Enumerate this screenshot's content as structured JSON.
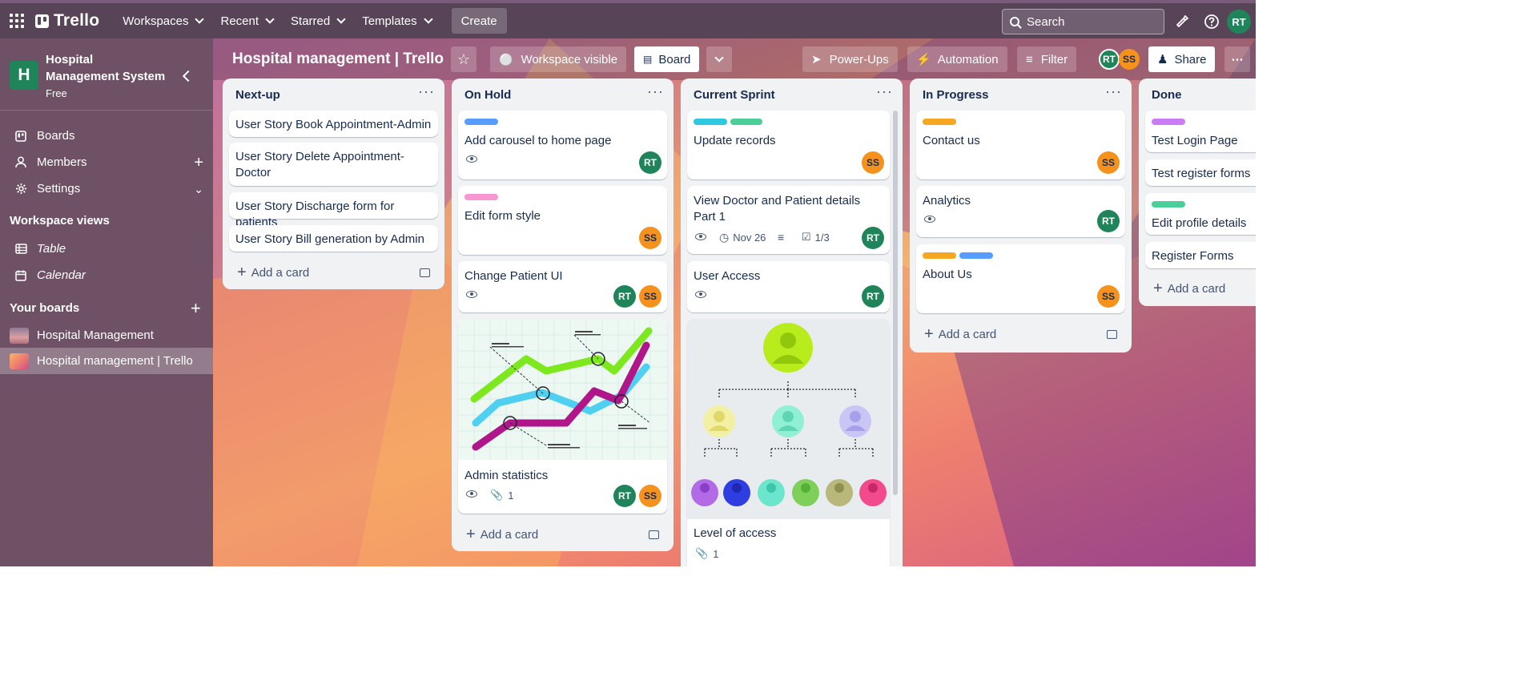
{
  "topbar": {
    "logo": "Trello",
    "nav": [
      "Workspaces",
      "Recent",
      "Starred",
      "Templates"
    ],
    "create": "Create",
    "search_placeholder": "Search",
    "user_initials": "RT"
  },
  "sidebar": {
    "workspace_name": "Hospital Management System",
    "workspace_initial": "H",
    "plan": "Free",
    "items": [
      {
        "label": "Boards",
        "icon": "board-icon"
      },
      {
        "label": "Members",
        "icon": "person-icon"
      },
      {
        "label": "Settings",
        "icon": "gear-icon"
      }
    ],
    "views_heading": "Workspace views",
    "views": [
      {
        "label": "Table",
        "icon": "table-icon"
      },
      {
        "label": "Calendar",
        "icon": "calendar-icon"
      }
    ],
    "boards_heading": "Your boards",
    "boards": [
      "Hospital Management",
      "Hospital management | Trello"
    ]
  },
  "board": {
    "title": "Hospital management | Trello",
    "visibility": "Workspace visible",
    "view": "Board",
    "powerups": "Power-Ups",
    "automation": "Automation",
    "filter": "Filter",
    "share": "Share",
    "members": [
      "RT",
      "SS"
    ]
  },
  "lists": [
    {
      "name": "Next-up",
      "cards": [
        {
          "title": "User Story Book Appointment-Admin"
        },
        {
          "title": "User Story Delete Appointment-Doctor"
        },
        {
          "title": "User Story Discharge form for patients"
        },
        {
          "title": "User Story Bill generation by Admin"
        }
      ],
      "add_card": "Add a card"
    },
    {
      "name": "On Hold",
      "cards": [
        {
          "title": "Add carousel to home page",
          "labels": [
            "#579dff"
          ],
          "members": [
            "RT"
          ]
        },
        {
          "title": "Edit form style",
          "labels": [
            "#f797d2"
          ],
          "members": [
            "SS"
          ]
        },
        {
          "title": "Change Patient UI",
          "members": [
            "RT",
            "SS"
          ]
        },
        {
          "title": "Admin statistics",
          "attachments": "1",
          "members": [
            "RT",
            "SS"
          ]
        }
      ],
      "add_card": "Add a card"
    },
    {
      "name": "Current Sprint",
      "cards": [
        {
          "title": "Update records",
          "labels": [
            "#2ec9e0",
            "#4bce97"
          ],
          "members": [
            "SS"
          ]
        },
        {
          "title": "View Doctor and Patient details Part 1",
          "due": "Nov 26",
          "checklist": "1/3",
          "members": [
            "RT"
          ]
        },
        {
          "title": "User Access",
          "members": [
            "RT"
          ]
        },
        {
          "title": "Level of access",
          "attachments": "1"
        }
      ]
    },
    {
      "name": "In Progress",
      "cards": [
        {
          "title": "Contact us",
          "labels": [
            "#f5a623"
          ],
          "members": [
            "SS"
          ]
        },
        {
          "title": "Analytics",
          "members": [
            "RT"
          ]
        },
        {
          "title": "About Us",
          "labels": [
            "#f5a623",
            "#579dff"
          ],
          "members": [
            "SS"
          ]
        }
      ],
      "add_card": "Add a card"
    },
    {
      "name": "Done",
      "cards": [
        {
          "title": "Test Login Page",
          "labels": [
            "#c97cf4"
          ]
        },
        {
          "title": "Test register forms"
        },
        {
          "title": "Edit profile details",
          "labels": [
            "#4bce97"
          ]
        },
        {
          "title": "Register Forms"
        }
      ],
      "add_card": "Add a card"
    }
  ]
}
